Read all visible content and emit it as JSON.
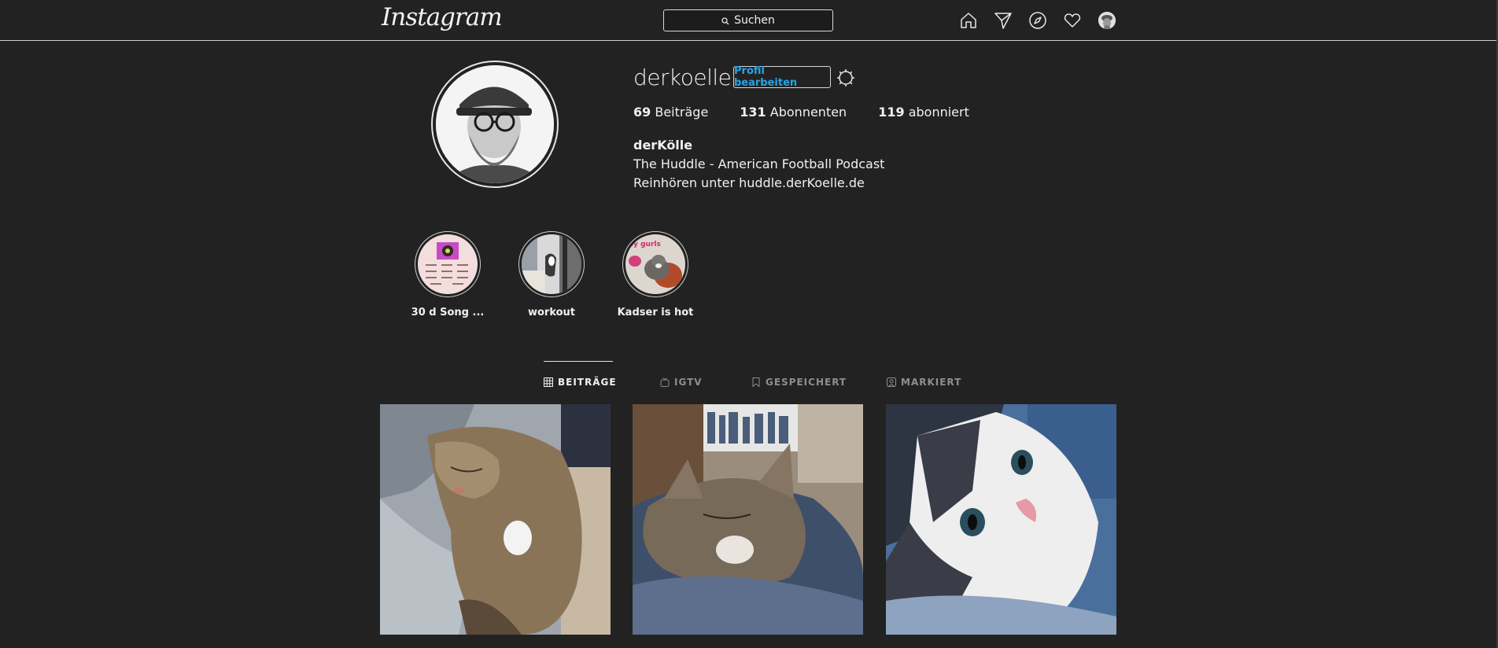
{
  "topbar": {
    "logo": "Instagram",
    "search_placeholder": "Suchen",
    "icons": [
      "home-icon",
      "direct-icon",
      "explore-icon",
      "activity-heart-icon",
      "profile-avatar"
    ]
  },
  "profile": {
    "username": "derkoelle",
    "edit_button": "Profil bearbeiten",
    "stats": [
      {
        "count": "69",
        "label": "Beiträge"
      },
      {
        "count": "131",
        "label": "Abonnenten"
      },
      {
        "count": "119",
        "label": "abonniert"
      }
    ],
    "full_name": "derKölle",
    "bio_lines": [
      "The Huddle - American Football Podcast",
      "Reinhören unter huddle.derKoelle.de"
    ]
  },
  "highlights": [
    {
      "label": "30 d Song ..."
    },
    {
      "label": "workout"
    },
    {
      "label": "Kadser is hot",
      "sticker_text": "ey gurls"
    }
  ],
  "tabs": [
    {
      "label": "BEITRÄGE",
      "icon": "grid-icon",
      "active": true
    },
    {
      "label": "IGTV",
      "icon": "igtv-icon",
      "active": false
    },
    {
      "label": "GESPEICHERT",
      "icon": "bookmark-icon",
      "active": false
    },
    {
      "label": "MARKIERT",
      "icon": "tagged-icon",
      "active": false
    }
  ],
  "colors": {
    "background": "#222222",
    "link_blue": "#28a3e6",
    "inactive_tab": "#8e8e8e"
  }
}
